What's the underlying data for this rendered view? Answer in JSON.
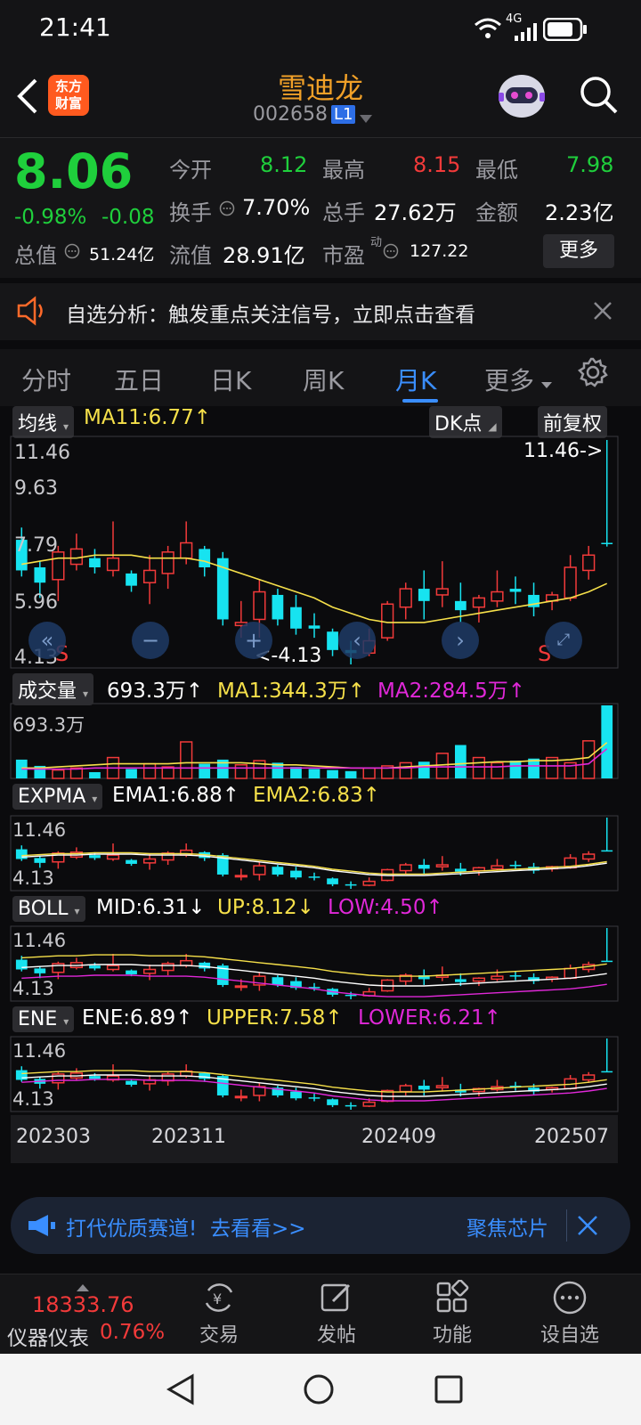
{
  "status_bar": {
    "time": "21:41",
    "network": "4G"
  },
  "header": {
    "back_icon": "back-arrow-icon",
    "logo_line1": "东方",
    "logo_line2": "财富",
    "title": "雪迪龙",
    "code": "002658",
    "level_badge": "L1",
    "avatar_icon": "robot-avatar-icon",
    "search_icon": "search-icon"
  },
  "quote": {
    "price": "8.06",
    "change_pct": "-0.98%",
    "change": "-0.08",
    "open_label": "今开",
    "open": "8.12",
    "high_label": "最高",
    "high": "8.15",
    "low_label": "最低",
    "low": "7.98",
    "turnover_label": "换手",
    "turnover": "7.70%",
    "volume_label": "总手",
    "volume": "27.62万",
    "amount_label": "金额",
    "amount": "2.23亿",
    "mktcap_label": "总值",
    "mktcap": "51.24亿",
    "float_label": "流值",
    "float": "28.91亿",
    "pe_label": "市盈",
    "pe_super": "动",
    "pe": "127.22",
    "more_button": "更多"
  },
  "banner": {
    "text": "自选分析：触发重点关注信号，立即点击查看"
  },
  "tabs": [
    {
      "label": "分时"
    },
    {
      "label": "五日"
    },
    {
      "label": "日K"
    },
    {
      "label": "周K"
    },
    {
      "label": "月K"
    },
    {
      "label": "更多"
    }
  ],
  "chart": {
    "ma_dropdown": "均线",
    "ma11": "MA11:6.77↑",
    "dk_button": "DK点",
    "adjust_button": "前复权",
    "main_ticks": [
      "11.46",
      "9.63",
      "7.79",
      "5.96",
      "4.13"
    ],
    "max_marker": "11.46->",
    "min_marker": "<-4.13",
    "s_marker": "S",
    "vol_dropdown": "成交量",
    "vol_value": "693.3万↑",
    "vol_ma1": "MA1:344.3万↑",
    "vol_ma2": "MA2:284.5万↑",
    "vol_tick": "693.3万",
    "expma_dropdown": "EXPMA",
    "ema1": "EMA1:6.88↑",
    "ema2": "EMA2:6.83↑",
    "boll_dropdown": "BOLL",
    "boll_mid": "MID:6.31↓",
    "boll_up": "UP:8.12↓",
    "boll_low": "LOW:4.50↑",
    "ene_dropdown": "ENE",
    "ene": "ENE:6.89↑",
    "ene_upper": "UPPER:7.58↑",
    "ene_lower": "LOWER:6.21↑",
    "sub_tick_high": "11.46",
    "sub_tick_low": "4.13",
    "dates": [
      "202303",
      "202311",
      "202409",
      "202507"
    ]
  },
  "chart_data": {
    "type": "candlestick",
    "ylim": [
      4.13,
      11.46
    ],
    "candles": [
      [
        8.2,
        7.2,
        8.6,
        7.0
      ],
      [
        7.3,
        6.8,
        7.5,
        6.3
      ],
      [
        6.9,
        7.8,
        8.0,
        6.2
      ],
      [
        7.4,
        7.9,
        8.4,
        7.2
      ],
      [
        7.6,
        7.3,
        7.9,
        7.1
      ],
      [
        7.2,
        7.6,
        8.8,
        7.0
      ],
      [
        7.1,
        6.7,
        7.2,
        6.5
      ],
      [
        6.8,
        7.2,
        7.7,
        6.1
      ],
      [
        7.1,
        7.8,
        8.0,
        6.6
      ],
      [
        7.6,
        8.1,
        8.8,
        7.4
      ],
      [
        7.9,
        7.3,
        8.0,
        7.0
      ],
      [
        7.6,
        5.6,
        7.8,
        5.4
      ],
      [
        5.4,
        5.5,
        6.2,
        5.0
      ],
      [
        5.6,
        6.5,
        6.9,
        5.0
      ],
      [
        6.4,
        5.6,
        6.6,
        5.4
      ],
      [
        6.0,
        5.3,
        6.4,
        5.1
      ],
      [
        5.4,
        5.3,
        5.8,
        5.0
      ],
      [
        5.2,
        4.6,
        5.3,
        4.4
      ],
      [
        4.6,
        4.5,
        4.9,
        4.13
      ],
      [
        4.5,
        4.9,
        5.3,
        4.4
      ],
      [
        5.0,
        6.1,
        6.2,
        4.9
      ],
      [
        6.0,
        6.6,
        6.8,
        5.6
      ],
      [
        6.6,
        6.2,
        7.2,
        5.6
      ],
      [
        6.4,
        6.6,
        7.5,
        6.0
      ],
      [
        6.2,
        5.9,
        6.8,
        5.5
      ],
      [
        6.0,
        6.3,
        6.4,
        5.5
      ],
      [
        6.2,
        6.5,
        7.2,
        6.0
      ],
      [
        6.6,
        6.5,
        7.0,
        6.1
      ],
      [
        6.4,
        6.0,
        6.8,
        5.7
      ],
      [
        6.2,
        6.4,
        6.5,
        5.9
      ],
      [
        6.3,
        7.3,
        7.7,
        6.2
      ],
      [
        7.2,
        7.7,
        8.0,
        6.9
      ],
      [
        8.1,
        8.06,
        11.46,
        7.98
      ]
    ],
    "ma11": [
      7.4,
      7.5,
      7.6,
      7.6,
      7.7,
      7.7,
      7.7,
      7.6,
      7.6,
      7.6,
      7.5,
      7.3,
      7.1,
      6.9,
      6.7,
      6.5,
      6.3,
      6.0,
      5.8,
      5.6,
      5.5,
      5.5,
      5.5,
      5.6,
      5.7,
      5.8,
      5.9,
      6.0,
      6.1,
      6.2,
      6.3,
      6.5,
      6.77
    ],
    "volume": [
      18,
      12,
      8,
      10,
      6,
      20,
      9,
      14,
      11,
      35,
      14,
      18,
      13,
      17,
      15,
      11,
      9,
      8,
      7,
      10,
      12,
      15,
      16,
      24,
      32,
      20,
      15,
      17,
      19,
      20,
      15,
      36,
      70
    ],
    "vol_ma1": [
      10,
      10,
      11,
      12,
      13,
      14,
      14,
      14,
      14,
      15,
      15,
      15,
      15,
      14,
      13,
      13,
      12,
      11,
      10,
      10,
      10,
      11,
      12,
      13,
      14,
      15,
      16,
      16,
      17,
      17,
      18,
      20,
      34.43
    ],
    "vol_ma2": [
      9,
      9,
      9,
      9,
      10,
      10,
      10,
      10,
      10,
      10,
      10,
      10,
      10,
      10,
      10,
      10,
      10,
      10,
      10,
      10,
      10,
      10,
      11,
      11,
      11,
      11,
      11,
      12,
      12,
      12,
      12,
      14,
      28.45
    ]
  },
  "ad": {
    "left_text": "打代优质赛道!",
    "link": "去看看>>",
    "right_text": "聚焦芯片"
  },
  "bottom": {
    "index_value": "18333.76",
    "index_name": "仪器仪表",
    "index_pct": "0.76%",
    "trade": "交易",
    "post": "发帖",
    "func": "功能",
    "fav": "设自选"
  }
}
